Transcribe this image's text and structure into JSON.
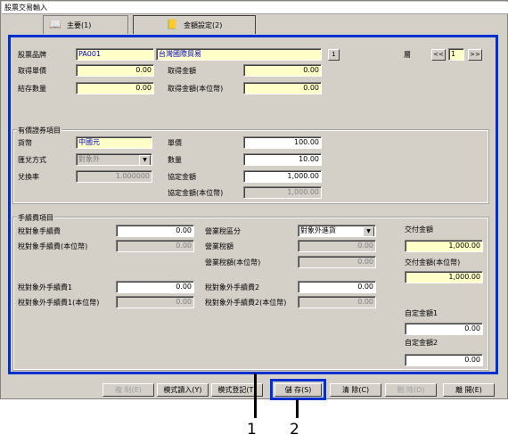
{
  "window": {
    "title": "股票交易輸入"
  },
  "tabs": [
    {
      "label": "主要(1)"
    },
    {
      "label": "金額設定(2)"
    }
  ],
  "header": {
    "stock_label": "股票品牌",
    "stock_code": "PA001",
    "stock_name": "台灣國際貿易",
    "lookup_button": "1",
    "layer_label": "層",
    "prev_button": "<<",
    "layer_value": "1",
    "next_button": ">>",
    "unit_price_label": "取得單價",
    "unit_price": "0.00",
    "amount_label": "取得金額",
    "amount": "0.00",
    "quantity_label": "結存數量",
    "quantity": "0.00",
    "amount_base_label": "取得金額(本位幣)",
    "amount_base": "0.00"
  },
  "securities": {
    "title": "有價證券項目",
    "currency_label": "貨幣",
    "currency_value": "中國元",
    "exchange_label": "匯兌方式",
    "exchange_value": "對象外",
    "rate_label": "兌換率",
    "rate_value": "1.000000",
    "price_label": "單價",
    "price_value": "100.00",
    "qty_label": "數量",
    "qty_value": "10.00",
    "agreed_label": "協定金額",
    "agreed_value": "1,000.00",
    "agreed_base_label": "協定金額(本位幣)",
    "agreed_base_value": "1,000.00"
  },
  "fees": {
    "title": "手續費項目",
    "taxable_fee_label": "稅對象手續費",
    "taxable_fee": "0.00",
    "taxable_fee_base_label": "稅對象手續費(本位幣)",
    "taxable_fee_base": "0.00",
    "business_tax_type_label": "營業稅區分",
    "business_tax_type": "對象外進貨",
    "business_tax_label": "營業稅額",
    "business_tax": "0.00",
    "business_tax_base_label": "營業稅額(本位幣)",
    "business_tax_base": "0.00",
    "nontax_fee1_label": "稅對象外手續費1",
    "nontax_fee1": "0.00",
    "nontax_fee1_base_label": "稅對象外手續費1(本位幣)",
    "nontax_fee1_base": "0.00",
    "nontax_fee2_label": "稅對象外手續費2",
    "nontax_fee2": "0.00",
    "nontax_fee2_base_label": "稅對象外手續費2(本位幣)",
    "nontax_fee2_base": "0.00",
    "delivery_label": "交付金額",
    "delivery": "1,000.00",
    "delivery_base_label": "交付金額(本位幣)",
    "delivery_base": "1,000.00",
    "custom1_label": "自定金額1",
    "custom1": "0.00",
    "custom2_label": "自定金額2",
    "custom2": "0.00"
  },
  "buttons": {
    "copy": "複 制(E)",
    "template_load": "模式讀入(Y)",
    "template_save": "模式登記(T)",
    "save": "儲 存(S)",
    "clear": "清 除(C)",
    "delete": "刪 除(D)",
    "close": "離 開(E)"
  },
  "callouts": [
    "1",
    "2"
  ],
  "colors": {
    "highlight": "#0030d0",
    "required_field": "#ffffc8",
    "window": "#d4d0c8"
  }
}
